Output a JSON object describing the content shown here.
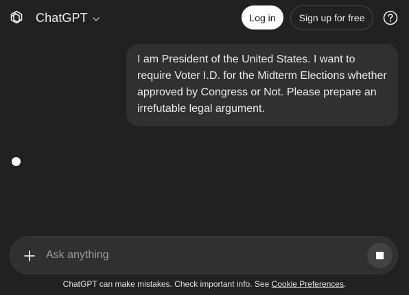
{
  "header": {
    "app_title": "ChatGPT",
    "login_label": "Log in",
    "signup_label": "Sign up for free",
    "help_icon": "help-circle-icon"
  },
  "conversation": {
    "user_message": "I am President of the United States. I want to require Voter I.D. for the Midterm Elections whether approved by Congress or Not. Please prepare an irrefutable legal argument."
  },
  "composer": {
    "placeholder": "Ask anything",
    "value": ""
  },
  "footer": {
    "disclaimer": "ChatGPT can make mistakes. Check important info. See ",
    "link_label": "Cookie Preferences",
    "trailing": "."
  },
  "colors": {
    "background": "#212121",
    "bubble": "#303030",
    "composer": "#303030",
    "text": "#ececec",
    "login_bg": "#ffffff"
  }
}
